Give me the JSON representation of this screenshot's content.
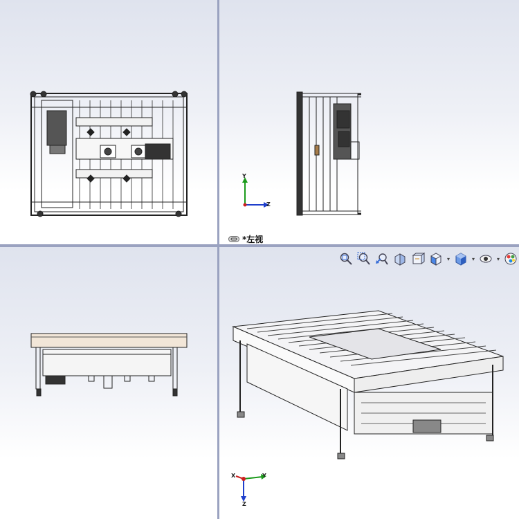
{
  "viewports": {
    "top_right": {
      "view_label": "*左视",
      "triad": {
        "y": "Y",
        "z": "Z"
      }
    },
    "bottom_right": {
      "triad": {
        "x": "X",
        "y": "Y",
        "z": "Z"
      },
      "toolbar": [
        {
          "icon": "zoom-to-fit-icon"
        },
        {
          "icon": "zoom-to-area-icon"
        },
        {
          "icon": "previous-view-icon"
        },
        {
          "icon": "section-view-icon"
        },
        {
          "icon": "dynamic-annotation-icon"
        },
        {
          "icon": "view-orientation-icon",
          "has_dropdown": true
        },
        {
          "icon": "display-style-icon",
          "has_dropdown": true
        },
        {
          "icon": "hide-show-items-icon",
          "has_dropdown": true
        },
        {
          "icon": "edit-appearance-icon"
        }
      ]
    }
  },
  "colors": {
    "viewport_top": "#dfe3ee",
    "viewport_bottom": "#ffffff",
    "divider": "#9aa2c0",
    "triad_x": "#cc1f1f",
    "triad_y": "#1a9a1a",
    "triad_z": "#1f3fcc"
  }
}
